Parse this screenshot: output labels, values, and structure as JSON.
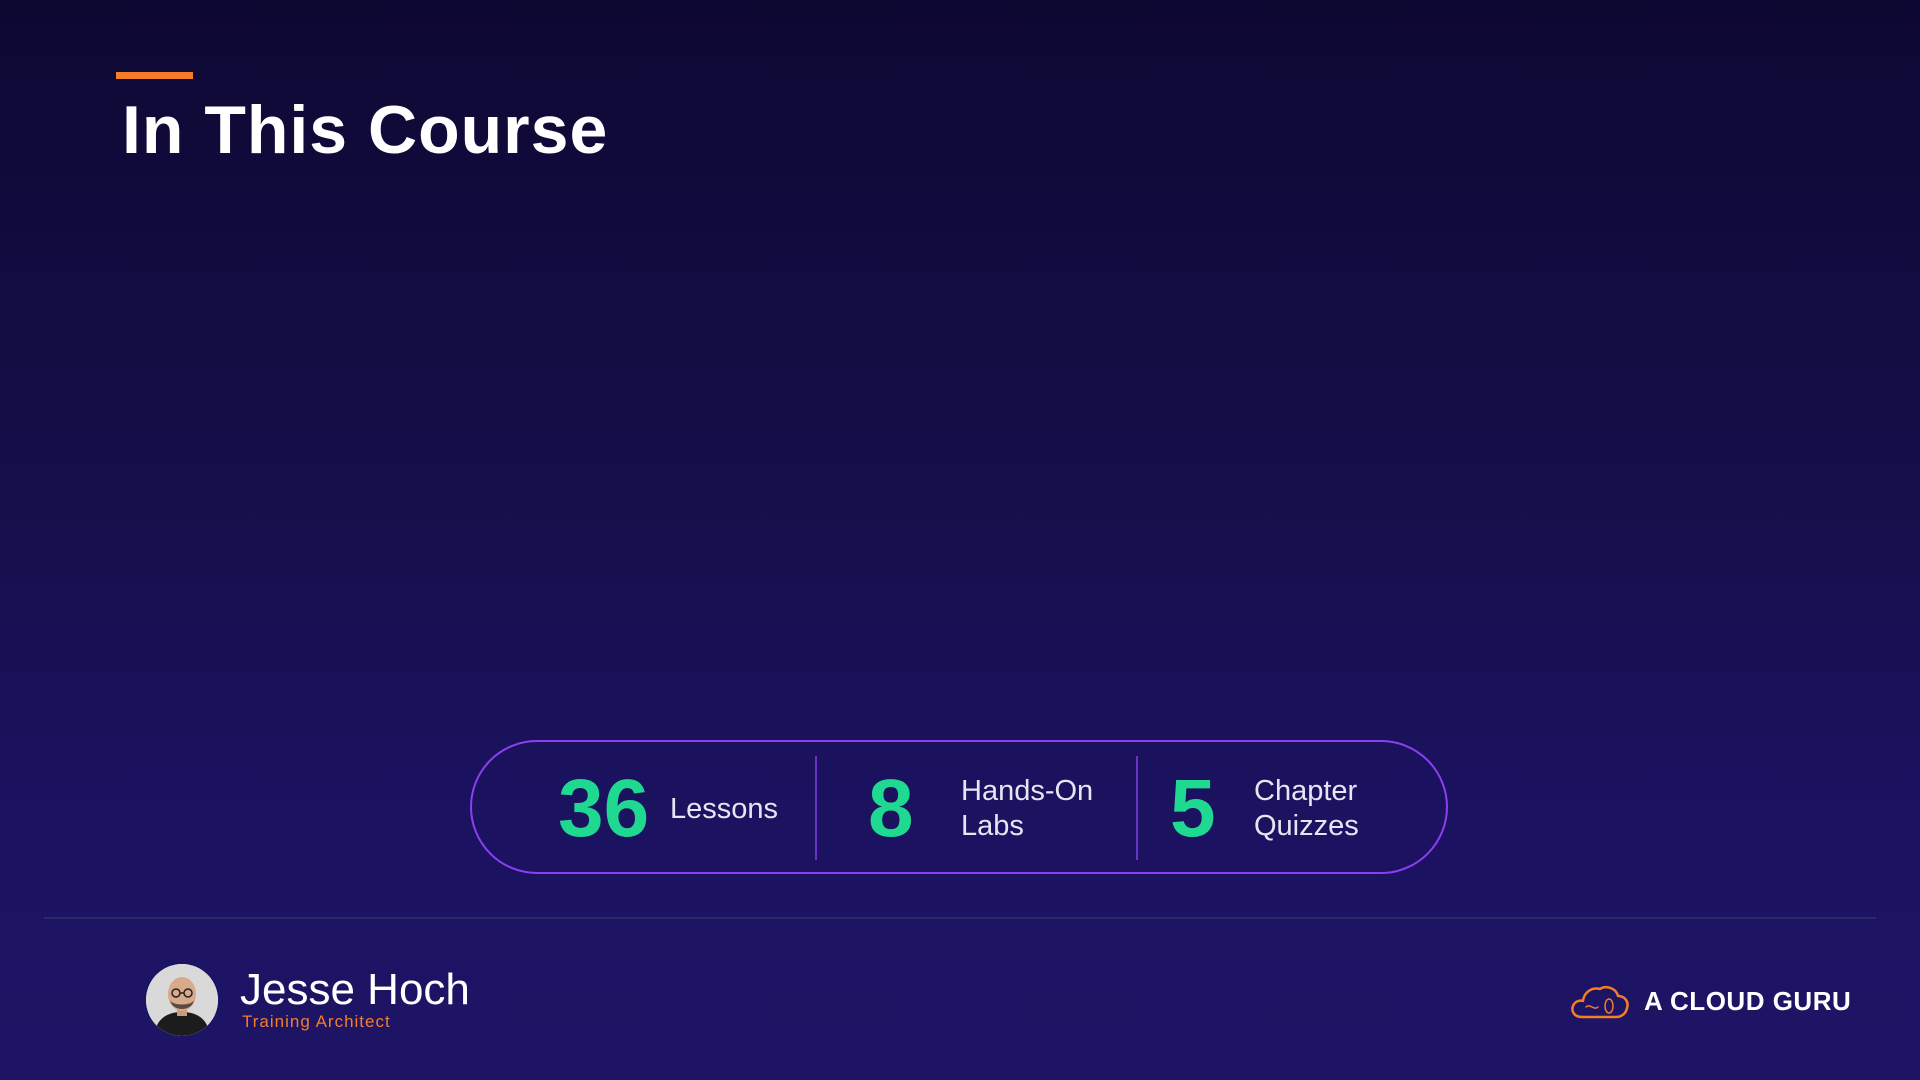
{
  "slide": {
    "title": "In This Course"
  },
  "stats": [
    {
      "number": "36",
      "label_lines": [
        "Lessons"
      ]
    },
    {
      "number": "8",
      "label_lines": [
        "Hands-On",
        "Labs"
      ]
    },
    {
      "number": "5",
      "label_lines": [
        "Chapter",
        "Quizzes"
      ]
    }
  ],
  "presenter": {
    "name": "Jesse Hoch",
    "role": "Training Architect"
  },
  "brand": {
    "logo_text": "A CLOUD GURU",
    "logo_icon": "cloud-icon"
  },
  "colors": {
    "accent_orange": "#f47d2a",
    "stat_green": "#20d990",
    "pill_border": "#8a3ff0",
    "background": "#150f4a"
  }
}
